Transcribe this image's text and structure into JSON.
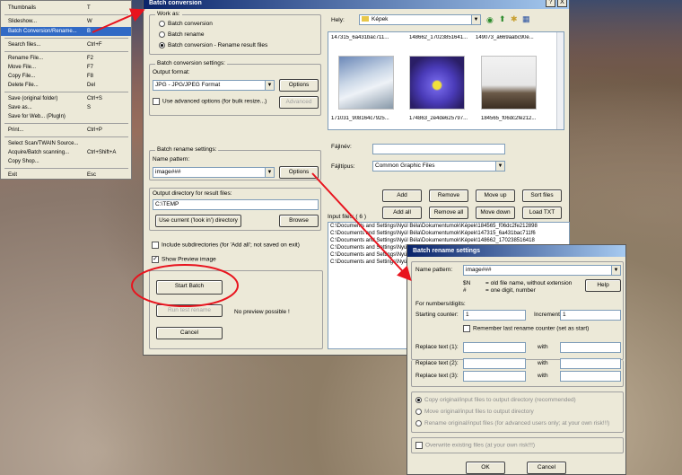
{
  "context_menu": {
    "items": [
      {
        "label": "Thumbnails",
        "shortcut": "T"
      },
      {
        "label": "Slideshow...",
        "shortcut": "W"
      },
      {
        "label": "Batch Conversion/Rename...",
        "shortcut": "B"
      },
      {
        "label": "Search files...",
        "shortcut": "Ctrl+F"
      },
      {
        "label": "Rename File...",
        "shortcut": "F2"
      },
      {
        "label": "Move File...",
        "shortcut": "F7"
      },
      {
        "label": "Copy File...",
        "shortcut": "F8"
      },
      {
        "label": "Delete File...",
        "shortcut": "Del"
      },
      {
        "label": "Save (original folder)",
        "shortcut": "Ctrl+S"
      },
      {
        "label": "Save as...",
        "shortcut": "S"
      },
      {
        "label": "Save for Web... (PlugIn)",
        "shortcut": ""
      },
      {
        "label": "Print...",
        "shortcut": "Ctrl+P"
      },
      {
        "label": "Select Scan/TWAIN Source...",
        "shortcut": ""
      },
      {
        "label": "Acquire/Batch scanning...",
        "shortcut": "Ctrl+Shift+A"
      },
      {
        "label": "Copy Shop...",
        "shortcut": ""
      },
      {
        "label": "Exit",
        "shortcut": "Esc"
      }
    ]
  },
  "batch": {
    "title": "Batch conversion",
    "close_glyph": "X",
    "help_glyph": "?",
    "work_as_label": "Work as:",
    "modes": [
      "Batch conversion",
      "Batch rename",
      "Batch conversion - Rename result files"
    ],
    "conv_settings_label": "Batch conversion settings:",
    "output_format_label": "Output format:",
    "output_format_value": "JPG - JPG/JPEG Format",
    "options_label": "Options",
    "advanced_check_label": "Use advanced options (for bulk resize...)",
    "advanced_button": "Advanced",
    "rename_settings_label": "Batch rename settings:",
    "name_pattern_label": "Name pattern:",
    "name_pattern_value": "image###",
    "options2_label": "Options",
    "output_dir_label": "Output directory for result files:",
    "output_dir_value": "C:\\TEMP",
    "use_current_button": "Use current ('look in') directory",
    "browse_button": "Browse",
    "include_subdirs_label": "Include subdirectories (for 'Add all'; not saved on exit)",
    "show_preview_label": "Show Preview image",
    "start_batch_button": "Start Batch",
    "run_test_button": "Run test rename",
    "cancel_button": "Cancel",
    "no_preview_text": "No preview possible !",
    "look_in_label": "Hely:",
    "look_in_value": "Képek",
    "thumbnails": [
      {
        "name": "147315_6a431bac711..."
      },
      {
        "name": "148662_17023851641..."
      },
      {
        "name": "149073_a669aabc90e..."
      },
      {
        "name": "171031_908164c7925..."
      },
      {
        "name": "174863_2e4de625797..."
      },
      {
        "name": "184565_f06dc2fe212..."
      }
    ],
    "filename_label": "Fájlnév:",
    "filetype_label": "Fájltípus:",
    "filetype_value": "Common Graphic Files",
    "add_button": "Add",
    "remove_button": "Remove",
    "move_up_button": "Move up",
    "sort_files_button": "Sort files",
    "add_all_button": "Add all",
    "remove_all_button": "Remove all",
    "move_down_button": "Move down",
    "load_txt_button": "Load TXT",
    "input_files_label": "Input files: ( 6 )",
    "input_files": [
      "C:\\Documents and Settings\\Nyúl Béla\\Dokumentumok\\Képek\\184565_f06dc2fe212898",
      "C:\\Documents and Settings\\Nyúl Béla\\Dokumentumok\\Képek\\147315_6a431bac711f6",
      "C:\\Documents and Settings\\Nyúl Béla\\Dokumentumok\\Képek\\148662_170238516418",
      "C:\\Documents and Settings\\Nyúl Béla",
      "C:\\Documents and Settings\\Nyúl Béla",
      "C:\\Documents and Settings\\Nyúl Béla"
    ]
  },
  "rename_dlg": {
    "title": "Batch rename settings",
    "name_pattern_label": "Name pattern:",
    "name_pattern_value": "image###",
    "legend_n_key": "$N",
    "legend_n_desc": "= old file name, without extension",
    "legend_hash_key": "#",
    "legend_hash_desc": "= one digit, number",
    "help_button": "Help",
    "numbers_label": "For numbers/digits:",
    "starting_counter_label": "Starting counter:",
    "starting_counter_value": "1",
    "increment_label": "Increment:",
    "increment_value": "1",
    "remember_label": "Remember last rename counter (set as start)",
    "replace_labels": [
      "Replace text (1):",
      "Replace text (2):",
      "Replace text (3):"
    ],
    "with_label": "with",
    "copy_option": "Copy original/input files to output directory (recommended)",
    "move_option": "Move original/input files to output directory",
    "rename_option": "Rename original/input files (for advanced users only; at your own risk!!!)",
    "overwrite_label": "Overwrite existing files (at your own risk!!!)",
    "ok_button": "OK",
    "cancel_button": "Cancel"
  },
  "colors": {
    "annotation_red": "#e8141e",
    "selection_blue": "#316ac5",
    "dialog_face": "#ece9d8"
  }
}
